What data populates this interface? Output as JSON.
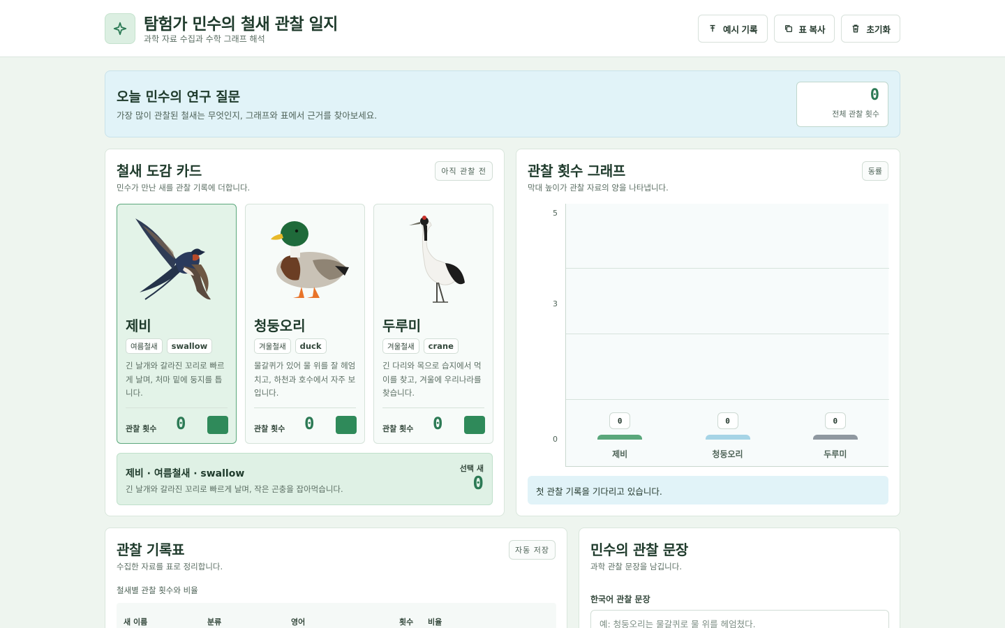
{
  "header": {
    "title": "탐험가 민수의 철새 관찰 일지",
    "subtitle": "과학 자료 수집과 수학 그래프 해석",
    "actions": {
      "example": "예시 기록",
      "copy": "표 복사",
      "reset": "초기화"
    }
  },
  "question": {
    "title": "오늘 민수의 연구 질문",
    "text": "가장 많이 관찰된 철새는 무엇인지, 그래프와 표에서 근거를 찾아보세요.",
    "total_value": "0",
    "total_label": "전체 관찰 횟수"
  },
  "guide": {
    "title": "철새 도감 카드",
    "desc": "민수가 만난 새를 관찰 기록에 더합니다.",
    "status": "아직 관찰 전",
    "count_label": "관찰 횟수",
    "birds": [
      {
        "name": "제비",
        "season": "여름철새",
        "english": "swallow",
        "desc": "긴 날개와 갈라진 꼬리로 빠르게 날며, 처마 밑에 둥지를 틉니다.",
        "count": "0"
      },
      {
        "name": "청둥오리",
        "season": "겨울철새",
        "english": "duck",
        "desc": "물갈퀴가 있어 물 위를 잘 헤엄치고, 하천과 호수에서 자주 보입니다.",
        "count": "0"
      },
      {
        "name": "두루미",
        "season": "겨울철새",
        "english": "crane",
        "desc": "긴 다리와 목으로 습지에서 먹이를 찾고, 겨울에 우리나라를 찾습니다.",
        "count": "0"
      }
    ],
    "selected": {
      "title": "제비 · 여름철새 · swallow",
      "desc": "긴 날개와 갈라진 꼬리로 빠르게 날며, 작은 곤충을 잡아먹습니다.",
      "label": "선택 새",
      "value": "0"
    }
  },
  "graph": {
    "title": "관찰 횟수 그래프",
    "desc": "막대 높이가 관찰 자료의 양을 나타냅니다.",
    "badge": "동률",
    "status": "첫 관찰 기록을 기다리고 있습니다."
  },
  "chart_data": {
    "type": "bar",
    "categories": [
      "제비",
      "청둥오리",
      "두루미"
    ],
    "values": [
      0,
      0,
      0
    ],
    "value_labels": [
      "0",
      "0",
      "0"
    ],
    "y_ticks": [
      "0",
      "3",
      "5"
    ],
    "ylim": [
      0,
      5
    ],
    "grid": true,
    "colors": [
      "#5aa77b",
      "#a6d4e6",
      "#8f98a0"
    ]
  },
  "table": {
    "title": "관찰 기록표",
    "desc": "수집한 자료를 표로 정리합니다.",
    "badge": "자동 저장",
    "subtitle": "철새별 관찰 횟수와 비율",
    "columns": [
      "새 이름",
      "분류",
      "영어",
      "횟수",
      "비율"
    ]
  },
  "note": {
    "title": "민수의 관찰 문장",
    "desc": "과학 관찰 문장을 남깁니다.",
    "field_label": "한국어 관찰 문장",
    "placeholder": "예: 청둥오리는 물갈퀴로 물 위를 헤엄쳤다."
  }
}
